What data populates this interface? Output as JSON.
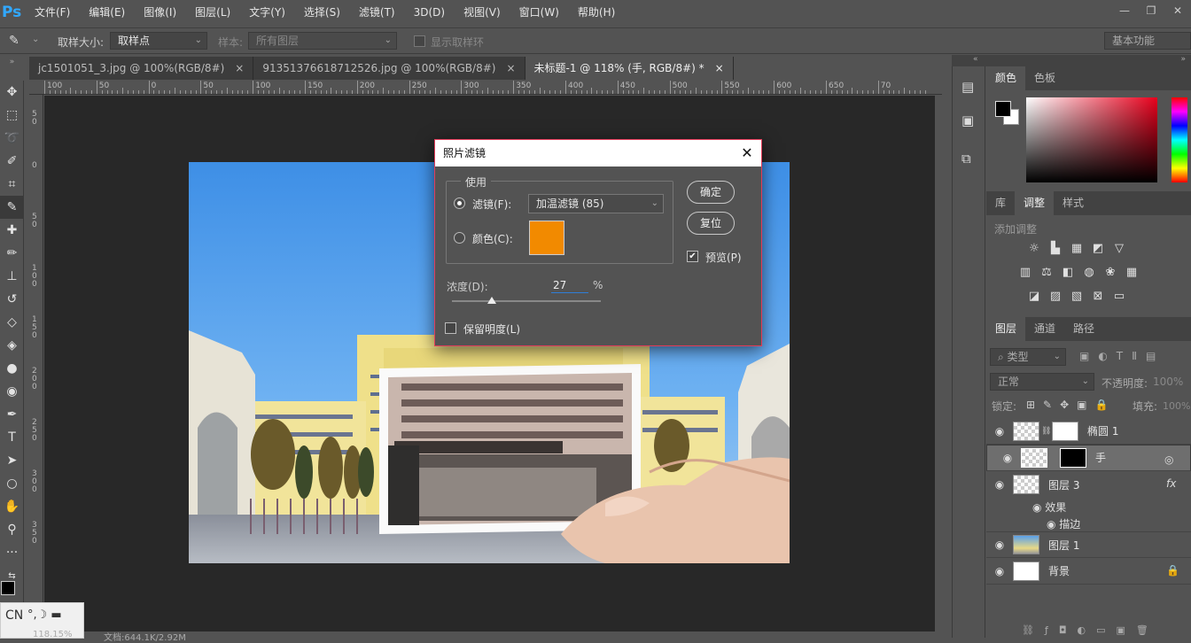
{
  "app": {
    "logo": "Ps"
  },
  "menu": [
    "文件(F)",
    "编辑(E)",
    "图像(I)",
    "图层(L)",
    "文字(Y)",
    "选择(S)",
    "滤镜(T)",
    "3D(D)",
    "视图(V)",
    "窗口(W)",
    "帮助(H)"
  ],
  "options": {
    "sample_size_label": "取样大小:",
    "sample_size_value": "取样点",
    "sample_label": "样本:",
    "sample_value": "所有图层",
    "show_ring_label": "显示取样环",
    "workspace": "基本功能"
  },
  "tabs": [
    {
      "label": "jc1501051_3.jpg @ 100%(RGB/8#)",
      "close": "×"
    },
    {
      "label": "91351376618712526.jpg @ 100%(RGB/8#)",
      "close": "×"
    },
    {
      "label": "未标题-1 @ 118% (手, RGB/8#) *",
      "close": "×"
    }
  ],
  "ruler_h": [
    "100",
    "50",
    "0",
    "50",
    "100",
    "150",
    "200",
    "250",
    "300",
    "350",
    "400",
    "450",
    "500",
    "550",
    "600",
    "650",
    "70"
  ],
  "ruler_v": [
    "50",
    "0",
    "50",
    "100",
    "150",
    "200",
    "250",
    "300",
    "350"
  ],
  "dialog": {
    "title": "照片滤镜",
    "group_label": "使用",
    "filter_label": "滤镜(F):",
    "filter_value": "加温滤镜 (85)",
    "color_label": "颜色(C):",
    "color_swatch": "#f28a00",
    "ok": "确定",
    "reset": "复位",
    "preview_label": "预览(P)",
    "density_label": "浓度(D):",
    "density_value": "27",
    "density_unit": "%",
    "density_level": 0.27,
    "preserve_label": "保留明度(L)"
  },
  "color_panel": {
    "tabs": [
      "颜色",
      "色板"
    ],
    "fg": "#000000",
    "bg": "#ffffff"
  },
  "adjust_panel": {
    "tabs": [
      "库",
      "调整",
      "样式"
    ],
    "add_label": "添加调整"
  },
  "layers_panel": {
    "tabs": [
      "图层",
      "通道",
      "路径"
    ],
    "filter_label": "类型",
    "blend_mode": "正常",
    "opacity_label": "不透明度:",
    "opacity_value": "100%",
    "lock_label": "锁定:",
    "fill_label": "填充:",
    "fill_value": "100%",
    "layers": [
      {
        "name": "椭圆 1"
      },
      {
        "name": "手"
      },
      {
        "name": "图层 3",
        "fx": "fx"
      },
      {
        "name": "图层 1"
      },
      {
        "name": "背景"
      }
    ],
    "effects_label": "效果",
    "stroke_label": "描边"
  },
  "status": {
    "zoom": "118.15%",
    "doc": "文档:644.1K/2.92M"
  },
  "ime": {
    "label": "CN"
  }
}
